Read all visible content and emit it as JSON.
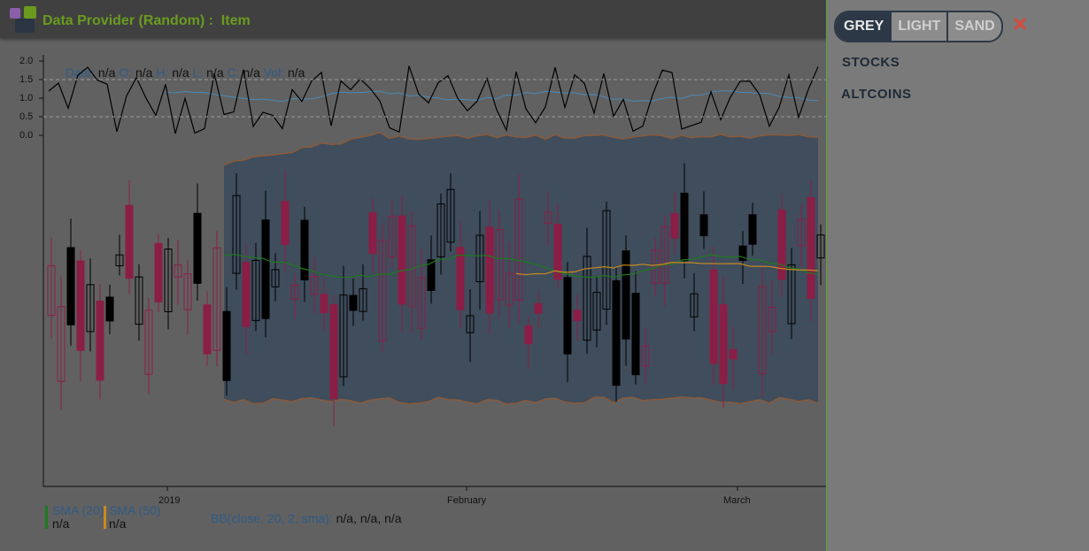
{
  "header": {
    "title": "Data Provider (Random) :  Item"
  },
  "ohlc_readout": {
    "date_label": "Date:",
    "date_value": "n/a",
    "o_label": "O:",
    "o_value": "n/a",
    "h_label": "H:",
    "h_value": "n/a",
    "l_label": "L:",
    "l_value": "n/a",
    "c_label": "C:",
    "c_value": "n/a",
    "vol_label": "Vol:",
    "vol_value": "n/a"
  },
  "indicator": {
    "y_ticks": [
      "2.0",
      "1.5",
      "1.0",
      "0.5",
      "0.0"
    ]
  },
  "x_axis": {
    "ticks": [
      "2019",
      "February",
      "March"
    ]
  },
  "legend": {
    "sma20_label": "SMA (20)",
    "sma20_value": "n/a",
    "sma50_label": "SMA (50)",
    "sma50_value": "n/a",
    "bb_label": "BB(close, 20, 2, sma):",
    "bb_value": "n/a, n/a, n/a"
  },
  "panel": {
    "themes": [
      "GREY",
      "LIGHT",
      "SAND"
    ],
    "active_theme": "GREY",
    "close_icon": "✕",
    "menu": [
      "STOCKS",
      "ALTCOINS"
    ]
  },
  "colors": {
    "header_title": "#6a9b1e",
    "up_candle": "#000000",
    "down_candle": "#8a1e46",
    "sma20": "#1e7a1e",
    "sma50": "#c88a1e",
    "bollinger_fill": "#3a4a5c",
    "bollinger_band": "#8a5a3a",
    "osc_line": "#000000",
    "osc_signal": "#4a8ab8",
    "panel_accent": "#57a82a",
    "close_icon": "#d84a3c"
  }
}
